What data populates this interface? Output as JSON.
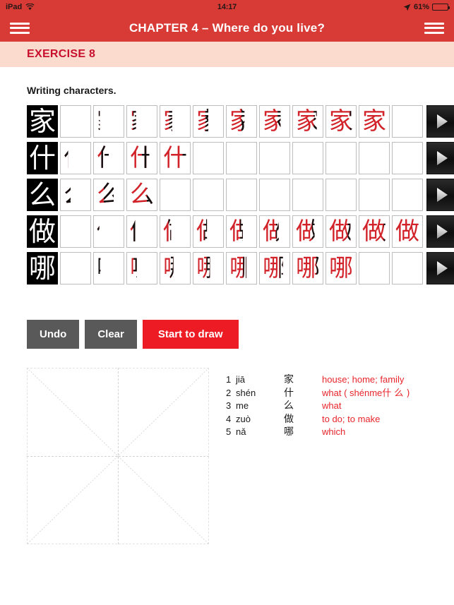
{
  "status_bar": {
    "device": "iPad",
    "wifi_icon": "wifi-icon",
    "time": "14:17",
    "location_icon": "location-arrow-icon",
    "battery_percent": "61%",
    "battery_icon": "battery-icon"
  },
  "nav": {
    "left_menu_icon": "hamburger-menu-icon",
    "title": "CHAPTER 4 –  Where do you live?",
    "right_menu_icon": "hamburger-menu-icon",
    "bar_color": "#D83A36"
  },
  "exercise": {
    "label": "EXERCISE 8",
    "band_color": "#FADBCD",
    "text_color": "#C8102E"
  },
  "main": {
    "heading": "Writing characters.",
    "stroke_color_done": "#D2232A",
    "stroke_color_new": "#111111",
    "rows": [
      {
        "character": "家",
        "total_cells": 11,
        "strokes_shown": 10,
        "play_icon": "play-icon"
      },
      {
        "character": "什",
        "total_cells": 11,
        "strokes_shown": 4,
        "play_icon": "play-icon"
      },
      {
        "character": "么",
        "total_cells": 11,
        "strokes_shown": 3,
        "play_icon": "play-icon"
      },
      {
        "character": "做",
        "total_cells": 11,
        "strokes_shown": 11,
        "play_icon": "play-icon"
      },
      {
        "character": "哪",
        "total_cells": 11,
        "strokes_shown": 9,
        "play_icon": "play-icon"
      }
    ]
  },
  "buttons": {
    "undo": "Undo",
    "clear": "Clear",
    "start": "Start to draw",
    "gray_color": "#595959",
    "red_color": "#ED1C24"
  },
  "canvas": {
    "name": "drawing-canvas",
    "guide": "mi-zi-ge-grid"
  },
  "vocabulary": [
    {
      "num": "1",
      "pinyin": "jiā",
      "char": "家",
      "meaning": "house; home; family",
      "meaning_cn": ""
    },
    {
      "num": "2",
      "pinyin": "shén",
      "char": "什",
      "meaning": "what ( shénme",
      "meaning_cn": "什 么 )"
    },
    {
      "num": "3",
      "pinyin": "me",
      "char": "么",
      "meaning": "what",
      "meaning_cn": ""
    },
    {
      "num": "4",
      "pinyin": "zuò",
      "char": "做",
      "meaning": "to do; to make",
      "meaning_cn": ""
    },
    {
      "num": "5",
      "pinyin": "nǎ",
      "char": "哪",
      "meaning": "which",
      "meaning_cn": ""
    }
  ]
}
